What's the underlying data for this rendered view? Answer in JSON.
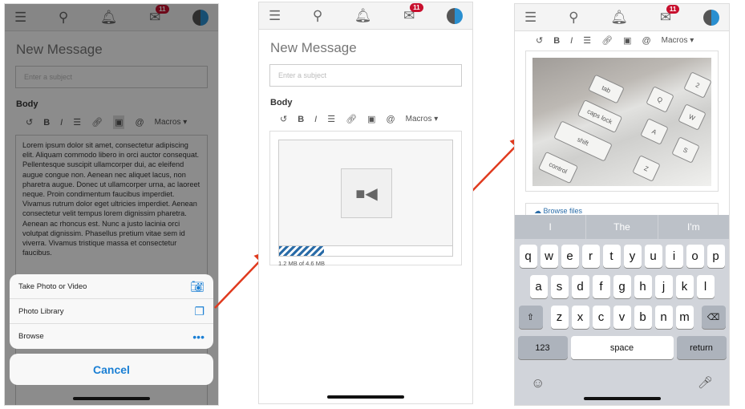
{
  "header": {
    "badge_count": "11"
  },
  "compose": {
    "title": "New Message",
    "subject_placeholder": "Enter a subject",
    "body_label": "Body",
    "toolbar": {
      "macros_label": "Macros ▾"
    },
    "body_text": "Lorem ipsum dolor sit amet, consectetur adipiscing elit. Aliquam commodo libero in orci auctor consequat. Pellentesque suscipit ullamcorper dui, ac eleifend augue congue non. Aenean nec aliquet lacus, non pharetra augue. Donec ut ullamcorper urna, ac laoreet neque. Proin condimentum faucibus imperdiet. Vivamus rutrum dolor eget ultricies imperdiet. Aenean consectetur velit tempus lorem dignissim pharetra. Aenean ac rhoncus est. Nunc a justo lacinia orci volutpat dignissim. Phasellus pretium vitae sem id viverra. Vivamus tristique massa et consectetur faucibus."
  },
  "action_sheet": {
    "items": [
      {
        "label": "Take Photo or Video",
        "icon": "camera-icon"
      },
      {
        "label": "Photo Library",
        "icon": "photo-library-icon"
      },
      {
        "label": "Browse",
        "icon": "more-icon"
      }
    ],
    "cancel": "Cancel"
  },
  "upload": {
    "progress_text": "1.2 MB of 4.6 MB",
    "progress_percent": 26
  },
  "photo_keys": [
    "tab",
    "caps lock",
    "shift",
    "control",
    "Q",
    "W",
    "A",
    "S",
    "Z",
    "2"
  ],
  "browse_files": "Browse files",
  "keyboard": {
    "suggestions": [
      "I",
      "The",
      "I'm"
    ],
    "row1": [
      "q",
      "w",
      "e",
      "r",
      "t",
      "y",
      "u",
      "i",
      "o",
      "p"
    ],
    "row2": [
      "a",
      "s",
      "d",
      "f",
      "g",
      "h",
      "j",
      "k",
      "l"
    ],
    "row3": [
      "z",
      "x",
      "c",
      "v",
      "b",
      "n",
      "m"
    ],
    "numbers": "123",
    "space": "space",
    "return": "return"
  },
  "colors": {
    "accent": "#1a7fd4",
    "badge": "#c8102e",
    "arrow": "#e03a1e"
  }
}
